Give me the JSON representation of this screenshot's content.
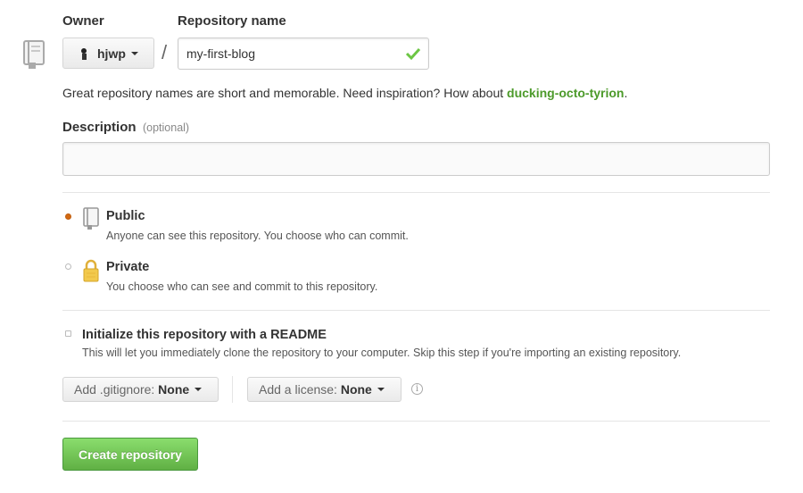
{
  "owner": {
    "label": "Owner",
    "value": "hjwp"
  },
  "repo": {
    "label": "Repository name",
    "value": "my-first-blog",
    "separator": "/"
  },
  "hint": {
    "text": "Great repository names are short and memorable. Need inspiration? How about ",
    "suggestion": "ducking-octo-tyrion",
    "end": "."
  },
  "description": {
    "label": "Description",
    "optional": "(optional)",
    "value": ""
  },
  "visibility": {
    "public": {
      "title": "Public",
      "desc": "Anyone can see this repository. You choose who can commit.",
      "selected": true
    },
    "private": {
      "title": "Private",
      "desc": "You choose who can see and commit to this repository.",
      "selected": false
    }
  },
  "readme": {
    "title": "Initialize this repository with a README",
    "desc": "This will let you immediately clone the repository to your computer. Skip this step if you're importing an existing repository.",
    "checked": false
  },
  "gitignore": {
    "prefix": "Add .gitignore: ",
    "value": "None"
  },
  "license": {
    "prefix": "Add a license: ",
    "value": "None"
  },
  "create": {
    "label": "Create repository"
  },
  "colors": {
    "accent_green": "#4c9a2a",
    "button_green": "#60b044",
    "radio_selected": "#d26911"
  }
}
